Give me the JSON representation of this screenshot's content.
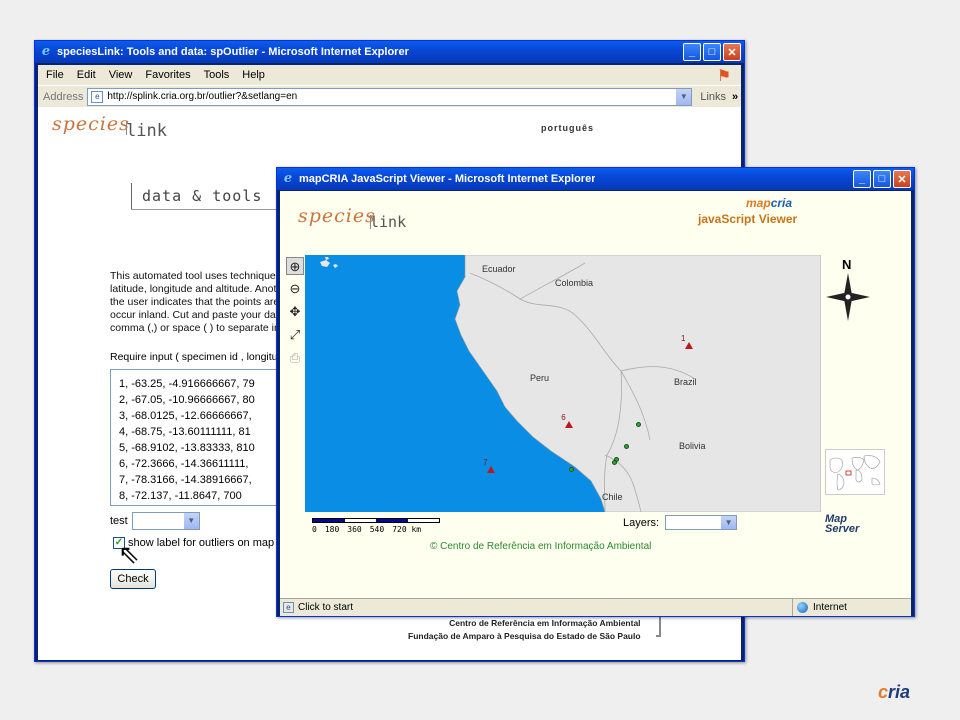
{
  "window1": {
    "title": "speciesLink: Tools and data: spOutlier - Microsoft Internet Explorer",
    "menu": [
      "File",
      "Edit",
      "View",
      "Favorites",
      "Tools",
      "Help"
    ],
    "address_label": "Address",
    "url": "http://splink.cria.org.br/outlier?&setlang=en",
    "links_label": "Links",
    "logo_species": "species",
    "logo_link": "link",
    "lang_link": "português",
    "tagline": "data & tools",
    "intro_lines": [
      "This automated tool uses techniques",
      "latitude, longitude and altitude. Anoth",
      "the user indicates that the points are",
      "occur inland. Cut and paste your data",
      "comma (,) or space ( ) to separate in"
    ],
    "require_label": "Require input ( specimen id , longitu",
    "data_rows": [
      "1, -63.25, -4.916666667, 79",
      "2, -67.05, -10.96666667, 80",
      "3, -68.0125, -12.66666667,",
      "4, -68.75, -13.60111111, 81",
      "5, -68.9102, -13.83333, 810",
      "6, -72.3666, -14.36611111,",
      "7, -78.3166, -14.38916667,",
      "8, -72.137, -11.8647, 700"
    ],
    "test_label": "test",
    "checkbox_label": "show label for outliers on map",
    "check_button": "Check",
    "footer_line1": "Centro de Referência em Informação Ambiental",
    "footer_line2": "Fundação de Amparo à Pesquisa do Estado de São Paulo"
  },
  "window2": {
    "title": "mapCRIA JavaScript Viewer - Microsoft Internet Explorer",
    "logo_species": "species",
    "logo_link": "link",
    "mapcria_map": "map",
    "mapcria_cria": "cria",
    "viewer_title": "javaScript Viewer",
    "countries": [
      "Ecuador",
      "Colombia",
      "Peru",
      "Brazil",
      "Bolivia",
      "Chile"
    ],
    "points": [
      {
        "label": "1",
        "lon": -63.25,
        "lat": -4.9167,
        "type": "outlier"
      },
      {
        "label": "6",
        "lon": -72.37,
        "lat": -11.0,
        "type": "outlier"
      },
      {
        "label": "7",
        "lon": -78.32,
        "lat": -14.39,
        "type": "outlier"
      },
      {
        "label": "",
        "lon": -67.05,
        "lat": -10.97,
        "type": "valid"
      },
      {
        "label": "",
        "lon": -68.01,
        "lat": -12.67,
        "type": "valid"
      },
      {
        "label": "",
        "lon": -68.75,
        "lat": -13.6,
        "type": "valid"
      },
      {
        "label": "",
        "lon": -68.91,
        "lat": -13.83,
        "type": "valid"
      },
      {
        "label": "",
        "lon": -72.14,
        "lat": -14.37,
        "type": "valid"
      }
    ],
    "compass_letter": "N",
    "scale_labels": [
      "0",
      "180",
      "360",
      "540",
      "720 km"
    ],
    "layers_label": "Layers:",
    "mapserver_line1": "Map",
    "mapserver_line2": "Server",
    "copyright": "© Centro de Referência em Informação Ambiental",
    "status_text": "Click to start",
    "zone_text": "Internet"
  },
  "corner_logo": {
    "prefix": "c",
    "rest": "ria"
  },
  "colors": {
    "outlier": "#c0181a",
    "valid": "#2fa52f",
    "ocean": "#0a8de5",
    "land": "#e6e6e6"
  }
}
